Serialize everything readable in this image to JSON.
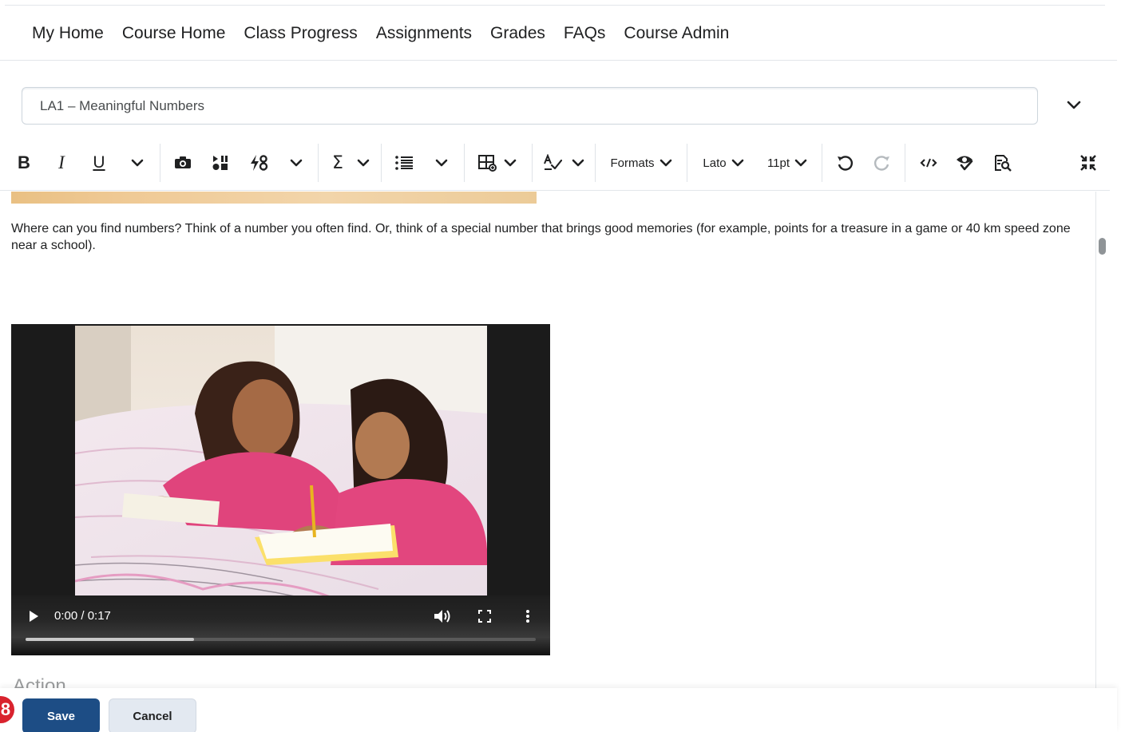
{
  "nav": {
    "items": [
      {
        "label": "My Home"
      },
      {
        "label": "Course Home"
      },
      {
        "label": "Class Progress"
      },
      {
        "label": "Assignments"
      },
      {
        "label": "Grades"
      },
      {
        "label": "FAQs"
      },
      {
        "label": "Course Admin"
      }
    ]
  },
  "title_field": {
    "value": "LA1 – Meaningful Numbers"
  },
  "toolbar": {
    "bold": "B",
    "italic": "I",
    "underline": "U",
    "sigma": "Σ",
    "formats": "Formats",
    "font": "Lato",
    "size": "11pt",
    "icons": [
      "bold-icon",
      "italic-icon",
      "underline-icon",
      "chevron-down-icon",
      "insert-image-icon",
      "insert-stuff-icon",
      "insert-quicklink-icon",
      "equation-icon",
      "bullet-list-icon",
      "table-icon",
      "spellcheck-icon",
      "undo-icon",
      "redo-icon",
      "source-code-icon",
      "accessibility-checker-icon",
      "preview-icon",
      "fullscreen-exit-icon"
    ]
  },
  "editor": {
    "paragraph": "Where can you find numbers? Think of a number you often find. Or, think of a special number that brings good memories (for example, points for a treasure in a game or 40 km speed zone near a school)."
  },
  "video": {
    "time": "0:00 / 0:17",
    "progress": 0.33
  },
  "action_heading": "Action",
  "footer": {
    "badge": "8",
    "save": "Save",
    "cancel": "Cancel"
  },
  "colors": {
    "primary": "#1d4d85",
    "secondary": "#e3e9f1",
    "badge": "#d9232e"
  }
}
